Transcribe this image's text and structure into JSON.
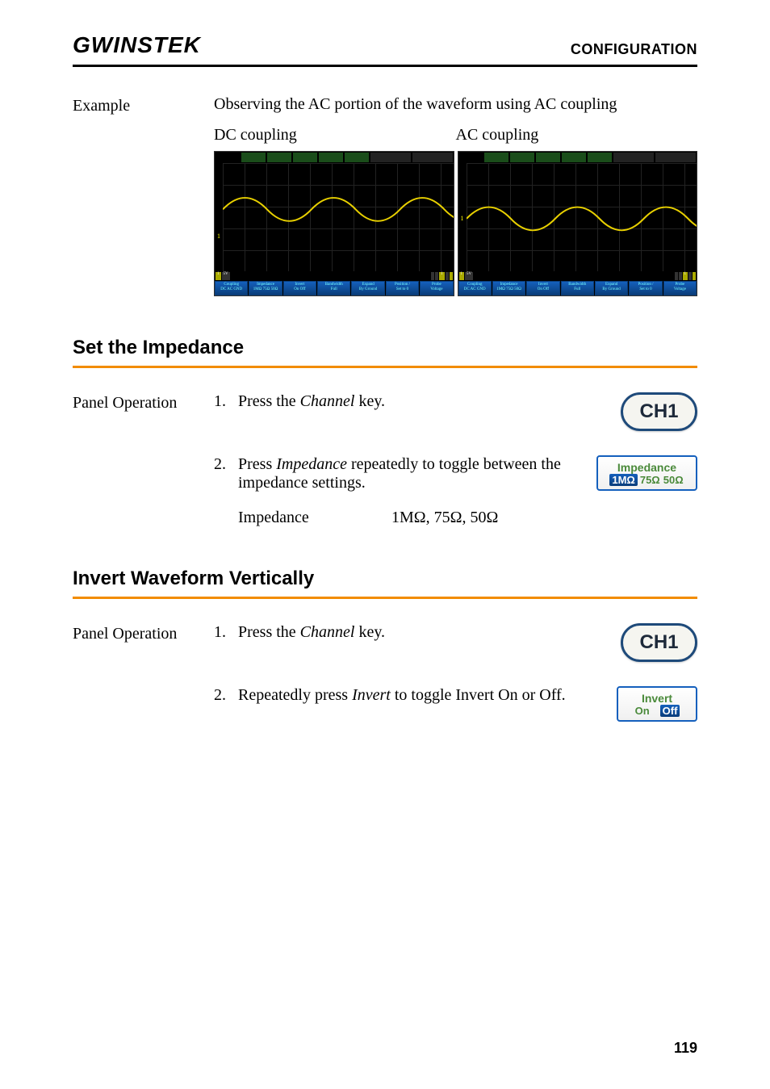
{
  "header": {
    "logo_text": "GWINSTEK",
    "section": "CONFIGURATION"
  },
  "example": {
    "label": "Example",
    "description": "Observing the AC portion of the waveform using AC coupling",
    "dc_label": "DC coupling",
    "ac_label": "AC coupling",
    "scope_menu": {
      "coupling": "Coupling",
      "coupling_opts": "DC AC GND",
      "impedance": "Impedance",
      "impedance_opts": "1MΩ 75Ω 50Ω",
      "invert": "Invert",
      "invert_opts": "On  Off",
      "bandwidth": "Bandwidth",
      "bandwidth_val": "Full",
      "expand": "Expand",
      "expand_val": "By Ground",
      "position": "Position /",
      "position_val": "Set to 0",
      "probe": "Probe",
      "probe_val": "Voltage"
    }
  },
  "sections": {
    "impedance": {
      "title": "Set the Impedance",
      "label": "Panel Operation",
      "step1_num": "1.",
      "step1_text_a": "Press the ",
      "step1_text_b": "Channel",
      "step1_text_c": " key.",
      "ch_button": "CH1",
      "step2_num": "2.",
      "step2_text_a": "Press ",
      "step2_text_b": "Impedance",
      "step2_text_c": " repeatedly to toggle between the impedance settings.",
      "soft_title": "Impedance",
      "soft_opts": {
        "a": "1MΩ",
        "b": "75Ω",
        "c": "50Ω"
      },
      "table_label": "Impedance",
      "table_value": "1MΩ, 75Ω, 50Ω"
    },
    "invert": {
      "title": "Invert Waveform Vertically",
      "label": "Panel Operation",
      "step1_num": "1.",
      "step1_text_a": "Press the ",
      "step1_text_b": "Channel",
      "step1_text_c": " key.",
      "ch_button": "CH1",
      "step2_num": "2.",
      "step2_text_a": "Repeatedly press ",
      "step2_text_b": "Invert",
      "step2_text_c": " to toggle Invert On or Off.",
      "soft_title": "Invert",
      "soft_opts": {
        "on": "On",
        "off": "Off"
      }
    }
  },
  "page_number": "119"
}
